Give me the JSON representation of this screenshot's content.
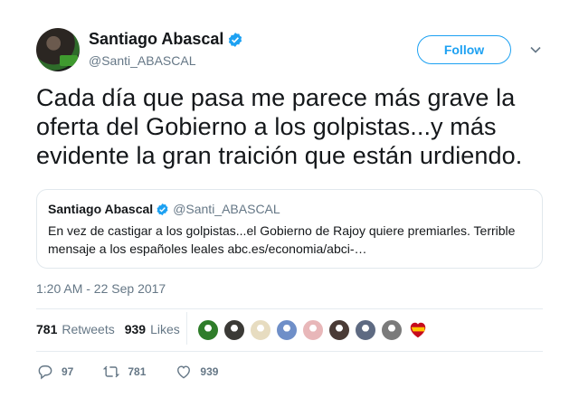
{
  "author": {
    "name": "Santiago Abascal",
    "handle": "@Santi_ABASCAL",
    "verified": true
  },
  "follow_button": {
    "label": "Follow"
  },
  "tweet": {
    "text": "Cada día que pasa me parece más grave la oferta del Gobierno a los golpistas...y más evidente la gran traición que  están urdiendo."
  },
  "quoted_tweet": {
    "name": "Santiago Abascal",
    "handle": "@Santi_ABASCAL",
    "text": "En vez de castigar a los golpistas...el Gobierno de Rajoy quiere premiarles. Terrible mensaje a los españoles leales abc.es/economia/abci-…"
  },
  "timestamp": "1:20 AM - 22 Sep 2017",
  "stats": {
    "retweets_count": "781",
    "retweets_label": "Retweets",
    "likes_count": "939",
    "likes_label": "Likes"
  },
  "likers": [
    {
      "icon": "avatar-green-flag",
      "color": "#2f7d2a"
    },
    {
      "icon": "avatar-sunglasses",
      "color": "#3b3a36"
    },
    {
      "icon": "avatar-light",
      "color": "#e7dcc0"
    },
    {
      "icon": "avatar-blue",
      "color": "#6f8fc8"
    },
    {
      "icon": "avatar-pink",
      "color": "#e8b7b9"
    },
    {
      "icon": "avatar-dark-person",
      "color": "#4a3b36"
    },
    {
      "icon": "avatar-group",
      "color": "#5e6a82"
    },
    {
      "icon": "avatar-grey-person",
      "color": "#7b7b7b"
    },
    {
      "icon": "avatar-spain-heart",
      "color": "#c60b1e"
    }
  ],
  "actions": {
    "replies": "97",
    "retweets": "781",
    "likes": "939"
  },
  "colors": {
    "accent": "#1da1f2",
    "text": "#14171a",
    "secondary": "#657786",
    "border": "#e1e8ed"
  }
}
